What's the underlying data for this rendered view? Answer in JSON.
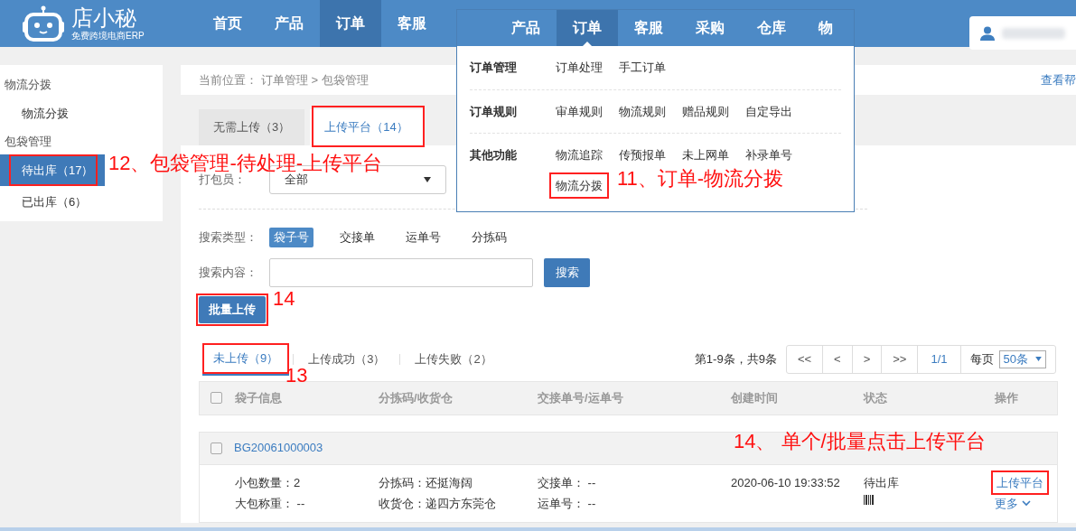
{
  "logo": {
    "name": "店小秘",
    "tagline": "免费跨境电商ERP"
  },
  "nav": [
    {
      "label": "首页",
      "selected": false
    },
    {
      "label": "产品",
      "selected": false
    },
    {
      "label": "订单",
      "selected": true
    },
    {
      "label": "客服",
      "selected": false
    }
  ],
  "dropdown": {
    "tabs": [
      {
        "label": "产品",
        "selected": false
      },
      {
        "label": "订单",
        "selected": true
      },
      {
        "label": "客服",
        "selected": false
      },
      {
        "label": "采购",
        "selected": false
      },
      {
        "label": "仓库",
        "selected": false
      },
      {
        "label": "物",
        "selected": false
      }
    ],
    "groups": [
      {
        "title": "订单管理",
        "links": [
          {
            "label": "订单处理",
            "highlighted": false
          },
          {
            "label": "手工订单",
            "highlighted": false
          }
        ]
      },
      {
        "title": "订单规则",
        "links": [
          {
            "label": "审单规则",
            "highlighted": false
          },
          {
            "label": "物流规则",
            "highlighted": false
          },
          {
            "label": "赠品规则",
            "highlighted": false
          },
          {
            "label": "自定导出",
            "highlighted": false
          }
        ]
      },
      {
        "title": "其他功能",
        "links": [
          {
            "label": "物流追踪",
            "highlighted": false
          },
          {
            "label": "传预报单",
            "highlighted": false
          },
          {
            "label": "未上网单",
            "highlighted": false
          },
          {
            "label": "补录单号",
            "highlighted": false
          },
          {
            "label": "物流分拨",
            "highlighted": true
          }
        ]
      }
    ]
  },
  "help_link": "查看帮",
  "sidebar": {
    "groups": [
      {
        "title": "物流分拨",
        "items": [
          {
            "label": "物流分拨",
            "selected": false,
            "highlighted": false
          }
        ]
      },
      {
        "title": "包袋管理",
        "items": [
          {
            "label": "待出库（17）",
            "selected": true,
            "highlighted": true
          },
          {
            "label": "已出库（6）",
            "selected": false,
            "highlighted": false
          }
        ]
      }
    ]
  },
  "breadcrumb": {
    "prefix": "当前位置：",
    "path": "订单管理 > 包袋管理"
  },
  "tabs": [
    {
      "label": "无需上传（3）",
      "selected": false,
      "highlighted": false
    },
    {
      "label": "上传平台（14）",
      "selected": true,
      "highlighted": true
    }
  ],
  "filters": {
    "packer_label": "打包员：",
    "packer_value": "全部",
    "search_type_label": "搜索类型：",
    "search_types": [
      {
        "label": "袋子号",
        "selected": true
      },
      {
        "label": "交接单",
        "selected": false
      },
      {
        "label": "运单号",
        "selected": false
      },
      {
        "label": "分拣码",
        "selected": false
      }
    ],
    "search_content_label": "搜索内容：",
    "search_button": "搜索"
  },
  "batch_button": {
    "label": "批量上传",
    "highlighted": true
  },
  "sub_tabs": [
    {
      "label": "未上传（9）",
      "selected": true,
      "highlighted": true
    },
    {
      "label": "上传成功（3）",
      "selected": false,
      "highlighted": false
    },
    {
      "label": "上传失败（2）",
      "selected": false,
      "highlighted": false
    }
  ],
  "pagination": {
    "summary": "第1-9条，共9条",
    "buttons": [
      "<<",
      "<",
      ">",
      ">>"
    ],
    "page": "1/1",
    "per_page_label": "每页",
    "per_page": "50条"
  },
  "table": {
    "select_all_checked": false,
    "columns": [
      "袋子信息",
      "分拣码/收货仓",
      "交接单号/运单号",
      "创建时间",
      "状态",
      "操作"
    ],
    "rows": [
      {
        "bag_no": "BG20061000003",
        "checked": false,
        "cells": [
          {
            "kind": "text",
            "lines": [
              "小包数量：2",
              "大包称重： --"
            ]
          },
          {
            "kind": "text",
            "lines": [
              "分拣码：还挺海阔",
              "收货仓：递四方东莞仓"
            ]
          },
          {
            "kind": "text",
            "lines": [
              "交接单： --",
              "运单号： --"
            ]
          },
          {
            "kind": "text",
            "lines": [
              "2020-06-10 19:33:52"
            ]
          },
          {
            "kind": "status",
            "lines": [
              "待出库"
            ]
          },
          {
            "kind": "actions",
            "lines": [
              "上传平台",
              "更多"
            ],
            "highlighted": true
          }
        ]
      }
    ]
  },
  "annotations": [
    {
      "text": "12、包袋管理-待处理-上传平台"
    },
    {
      "text": "11、订单-物流分拨"
    },
    {
      "text": "14"
    },
    {
      "text": "13"
    },
    {
      "text": "14、 单个/批量点击上传平台"
    }
  ]
}
